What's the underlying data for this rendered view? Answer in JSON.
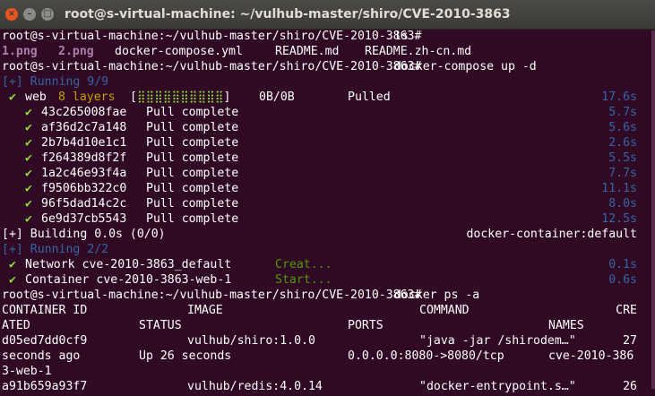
{
  "window": {
    "title": "root@s-virtual-machine: ~/vulhub-master/shiro/CVE-2010-3863"
  },
  "prompt": "root@s-virtual-machine:~/vulhub-master/shiro/CVE-2010-3863#",
  "cmd1": " ls",
  "ls": {
    "f1": "1.png",
    "f2": "2.png",
    "f3": "docker-compose.yml",
    "f4": "README.md",
    "f5": "README.zh-cn.md"
  },
  "cmd2": " docker-compose up -d",
  "running1": "[+] Running 9/9",
  "web": {
    "check": "✔",
    "name": "web",
    "layers": "8 layers",
    "bar": "[⣿⣿⣿⣿⣿⣿⣿⣿⣿⣿]",
    "size": "0B/0B",
    "state": "Pulled",
    "time": "17.6s"
  },
  "layers": [
    {
      "check": "✔",
      "id": "43c265008fae",
      "status": "Pull complete",
      "time": "5.7s"
    },
    {
      "check": "✔",
      "id": "af36d2c7a148",
      "status": "Pull complete",
      "time": "5.6s"
    },
    {
      "check": "✔",
      "id": "2b7b4d10e1c1",
      "status": "Pull complete",
      "time": "2.6s"
    },
    {
      "check": "✔",
      "id": "f264389d8f2f",
      "status": "Pull complete",
      "time": "5.5s"
    },
    {
      "check": "✔",
      "id": "1a2c46e93f4a",
      "status": "Pull complete",
      "time": "7.7s"
    },
    {
      "check": "✔",
      "id": "f9506bb322c0",
      "status": "Pull complete",
      "time": "11.1s"
    },
    {
      "check": "✔",
      "id": "96f5dad14c2c",
      "status": "Pull complete",
      "time": "8.0s"
    },
    {
      "check": "✔",
      "id": "6e9d37cb5543",
      "status": "Pull complete",
      "time": "12.5s"
    }
  ],
  "building": {
    "text": "[+] Building 0.0s (0/0)",
    "right": "docker-container:default"
  },
  "running2": "[+] Running 2/2",
  "network": {
    "check": "✔",
    "text": "Network cve-2010-3863_default",
    "state": "Creat...",
    "time": "0.1s"
  },
  "container": {
    "check": "✔",
    "text": "Container cve-2010-3863-web-1",
    "state": "Start...",
    "time": "0.6s"
  },
  "cmd3": " docker ps -a",
  "ps": {
    "h1": {
      "id": "CONTAINER ID",
      "image": "IMAGE",
      "command": "COMMAND",
      "cre": "CRE"
    },
    "h2": {
      "ated": "ATED",
      "status": "STATUS",
      "ports": "PORTS",
      "names": "NAMES"
    },
    "r1": {
      "id": "d05ed7dd0cf9",
      "image": "vulhub/shiro:1.0.0",
      "command": "\"java -jar /shirodem…\"",
      "cre": "27"
    },
    "r2": {
      "ago": "seconds ago",
      "status": "Up 26 seconds",
      "ports": "0.0.0.0:8080->8080/tcp",
      "names": "cve-2010-386"
    },
    "r3": {
      "cont": "3-web-1"
    },
    "r4": {
      "id": "a91b659a93f7",
      "image": "vulhub/redis:4.0.14",
      "command": "\"docker-entrypoint.s…\"",
      "cre": "26"
    }
  }
}
